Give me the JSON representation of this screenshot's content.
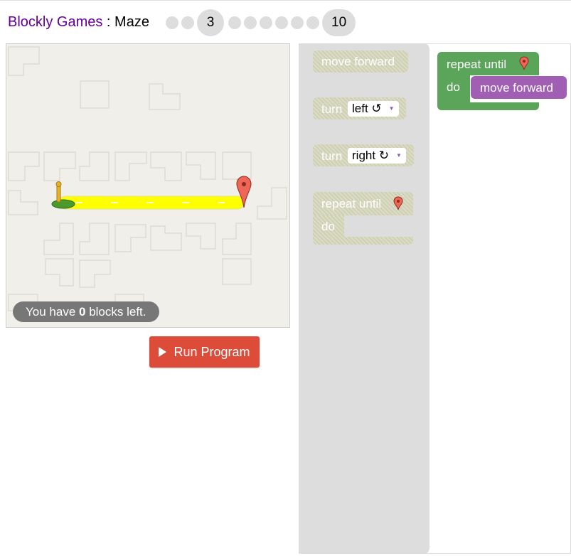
{
  "header": {
    "app_name": "Blockly Games",
    "separator": " : ",
    "game_name": "Maze",
    "levels": [
      {
        "label": "",
        "type": "dot"
      },
      {
        "label": "",
        "type": "dot"
      },
      {
        "label": "3",
        "type": "current"
      },
      {
        "label": "",
        "type": "dot"
      },
      {
        "label": "",
        "type": "dot"
      },
      {
        "label": "",
        "type": "dot"
      },
      {
        "label": "",
        "type": "dot"
      },
      {
        "label": "",
        "type": "dot"
      },
      {
        "label": "",
        "type": "dot"
      },
      {
        "label": "10",
        "type": "last"
      }
    ]
  },
  "maze": {
    "capacity_prefix": "You have ",
    "capacity_count": "0",
    "capacity_suffix": " blocks left.",
    "path_color": "#ffff00",
    "start_color": "#4c9a2a",
    "goal_color": "#ee6655"
  },
  "controls": {
    "run_label": "Run Program"
  },
  "toolbox": {
    "move_forward": "move forward",
    "turn_left_label": "turn",
    "turn_left_value": "left ↺",
    "turn_right_label": "turn",
    "turn_right_value": "right ↻",
    "repeat_label": "repeat until",
    "repeat_do": "do",
    "disabled_color": "#cfd0b3"
  },
  "workspace": {
    "repeat_label": "repeat until",
    "repeat_do": "do",
    "inner_block": "move forward",
    "loop_color": "#5ba55b",
    "move_color": "#a05fb3"
  }
}
